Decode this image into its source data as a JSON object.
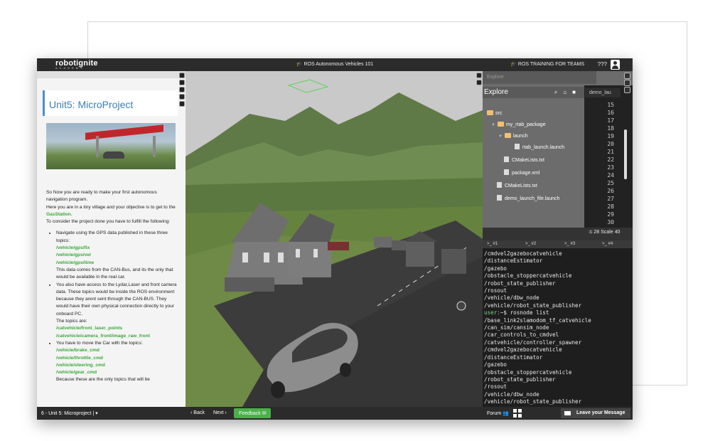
{
  "topbar": {
    "logo": "robotignite",
    "logo_sub": "ACADEMY",
    "course_title": "ROS Autonomous Vehicles 101",
    "training_link": "ROS TRAINING FOR TEAMS",
    "user_label": "???"
  },
  "lesson": {
    "unit_title": "Unit5: MicroProject",
    "intro": [
      "So Now you are ready to make your first autonomous navigation program.",
      "Here you are in a tiny village and your objective is to get to the ",
      "GasStation",
      ".",
      "To consider the project done you have to fulfill the following:"
    ],
    "bullet1_text": "Navigate using the GPS data published in these three topics:",
    "gps_topics": [
      "/vehicle/gps/fix",
      "/vehicle/gps/vel",
      "/vehicle/gps/time"
    ],
    "bullet1_note": "This data comes from the CAN-Bus, and its the only that would be available in the real car.",
    "bullet2_text": "You also have access to the Lydar,Laser and front camera data. These topics would be inside the ROS environment because they arent sent through the CAN-BUS. They would have their own physical connection directly to your onboard PC.",
    "bullet2_topics_label": "The topics are:",
    "sensor_topics": [
      "/catvehicle/front_laser_points",
      "/catvehicle/camera_front/image_raw_front"
    ],
    "bullet3_text": "You have to move the Car with the topics:",
    "control_topics": [
      "/vehicle/brake_cmd",
      "/vehicle/throttle_cmd",
      "/vehicle/steering_cmd",
      "/vehicle/gear_cmd"
    ],
    "bullet3_note": "Because these are the only topics that will be"
  },
  "explorer": {
    "search_placeholder": "Explore",
    "title": "Explore",
    "tree": [
      {
        "name": "src",
        "type": "folder"
      },
      {
        "name": "my_rtab_package",
        "type": "folder"
      },
      {
        "name": "launch",
        "type": "folder"
      },
      {
        "name": "rtab_launch.launch",
        "type": "file"
      },
      {
        "name": "CMakeLists.txt",
        "type": "file"
      },
      {
        "name": "package.xml",
        "type": "file"
      },
      {
        "name": "CMakeLists.txt",
        "type": "file"
      },
      {
        "name": "demo_launch_file.launch",
        "type": "file"
      }
    ]
  },
  "editor": {
    "tab_label": "demo_lau",
    "line_numbers": [
      "15",
      "16",
      "17",
      "18",
      "19",
      "20",
      "21",
      "22",
      "23",
      "24",
      "25",
      "26",
      "27",
      "28",
      "29",
      "30"
    ],
    "status": ":c 28  Scale 40"
  },
  "terminal": {
    "tabs": [
      ">_ #1",
      ">_ #2",
      ">_ #3",
      ">_ #4"
    ],
    "lines": [
      "/cmdvel2gazebocatvehicle",
      "/distanceEstimator",
      "/gazebo",
      "/obstacle_stoppercatvehicle",
      "/robot_state_publisher",
      "/rosout",
      "/vehicle/dbw_node",
      "/vehicle/robot_state_publisher"
    ],
    "prompt": "user:",
    "command": "~$ rosnode list",
    "output": [
      "/base_link2slamodom_tf_catvehicle",
      "/can_sim/cansim_node",
      "/car_controls_to_cmdvel",
      "/catvehicle/controller_spawner",
      "/cmdvel2gazebocatvehicle",
      "/distanceEstimator",
      "/gazebo",
      "/obstacle_stoppercatvehicle",
      "/robot_state_publisher",
      "/rosout",
      "/vehicle/dbw_node",
      "/vehicle/robot_state_publisher"
    ]
  },
  "bottombar": {
    "unit_select": "6 - Unit 5: Microproject |",
    "back": "‹ Back",
    "next": "Next ›",
    "feedback": "Feedback",
    "forum": "Forum",
    "message": "Leave your Message"
  },
  "colors": {
    "accent_green": "#4ab04a",
    "title_blue": "#3a7fb8",
    "bar_dark": "#2b2b2b",
    "topic_green": "#3aa83a"
  }
}
